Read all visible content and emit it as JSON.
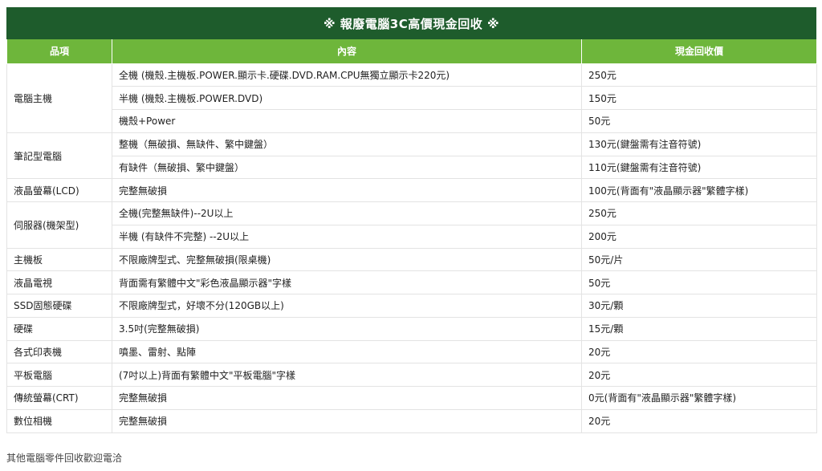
{
  "title": "※ 報廢電腦3C高價現金回收 ※",
  "headers": {
    "item": "品項",
    "content": "內容",
    "price": "現金回收價"
  },
  "rows": [
    {
      "cat": "電腦主機",
      "span": 3,
      "content": "全機 (機殼.主機板.POWER.顯示卡.硬碟.DVD.RAM.CPU無獨立顯示卡220元)",
      "price": "250元"
    },
    {
      "content": "半機 (機殼.主機板.POWER.DVD)",
      "price": "150元"
    },
    {
      "content": "機殼+Power",
      "price": "50元"
    },
    {
      "cat": "筆記型電腦",
      "span": 2,
      "content": "整機（無破損、無缺件、繁中鍵盤）",
      "price": "130元(鍵盤需有注音符號)"
    },
    {
      "content": "有缺件（無破損、繁中鍵盤）",
      "price": "110元(鍵盤需有注音符號)"
    },
    {
      "cat": "液晶螢幕(LCD)",
      "span": 1,
      "content": "完整無破損",
      "price": "100元(背面有\"液晶顯示器\"繁體字樣)"
    },
    {
      "cat": "伺服器(機架型)",
      "span": 2,
      "content": "全機(完整無缺件)--2U以上",
      "price": "250元"
    },
    {
      "content": "半機 (有缺件不完整) --2U以上",
      "price": "200元"
    },
    {
      "cat": "主機板",
      "span": 1,
      "content": "不限廠牌型式、完整無破損(限桌機)",
      "price": "50元/片"
    },
    {
      "cat": "液晶電視",
      "span": 1,
      "content": "背面需有繁體中文\"彩色液晶顯示器\"字樣",
      "price": "50元"
    },
    {
      "cat": "SSD固態硬碟",
      "span": 1,
      "content": "不限廠牌型式，好壞不分(120GB以上)",
      "price": "30元/顆"
    },
    {
      "cat": "硬碟",
      "span": 1,
      "content": "3.5吋(完整無破損)",
      "price": "15元/顆"
    },
    {
      "cat": "各式印表機",
      "span": 1,
      "content": "噴墨、雷射、點陣",
      "price": "20元"
    },
    {
      "cat": "平板電腦",
      "span": 1,
      "content": "(7吋以上)背面有繁體中文\"平板電腦\"字樣",
      "price": "20元"
    },
    {
      "cat": "傳統螢幕(CRT)",
      "span": 1,
      "content": "完整無破損",
      "price": "0元(背面有\"液晶顯示器\"繁體字樣)"
    },
    {
      "cat": "數位相機",
      "span": 1,
      "content": "完整無破損",
      "price": "20元"
    }
  ],
  "footer": "其他電腦零件回收歡迎電洽"
}
